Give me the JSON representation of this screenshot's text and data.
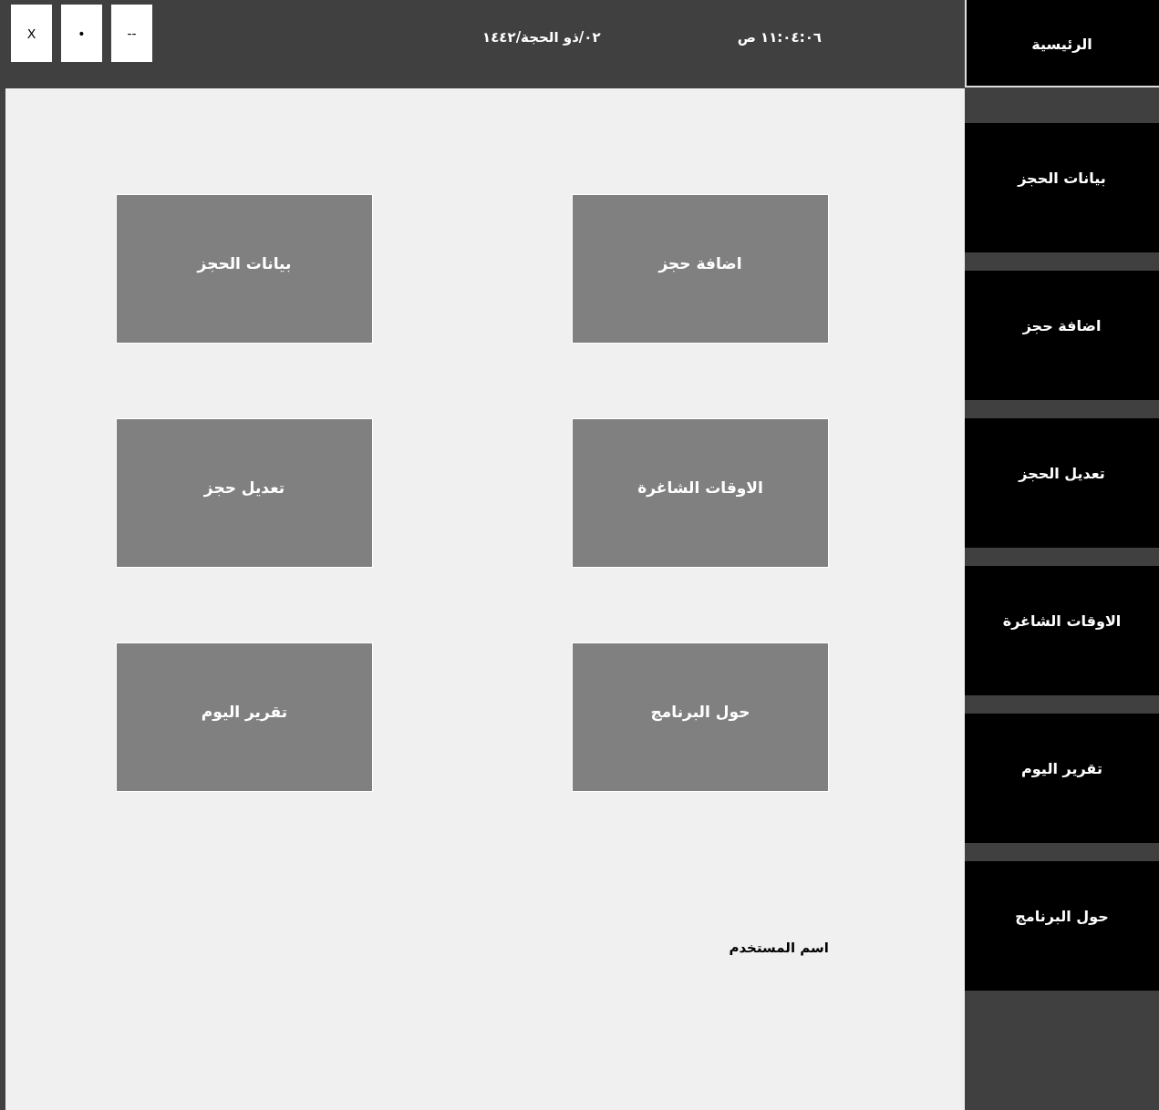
{
  "window_controls": [
    {
      "label": "--"
    },
    {
      "label": "•"
    },
    {
      "label": "X"
    }
  ],
  "header": {
    "date": "٠٢/ذو الحجة/١٤٤٢",
    "time": "١١:٠٤:٠٦ ص"
  },
  "sidebar": {
    "items": [
      {
        "label": "الرئيسية",
        "selected": true
      },
      {
        "label": "بيانات الحجز",
        "selected": false
      },
      {
        "label": "اضافة حجز",
        "selected": false
      },
      {
        "label": "تعديل الحجز",
        "selected": false
      },
      {
        "label": "الاوقات الشاغرة",
        "selected": false
      },
      {
        "label": "تقرير اليوم",
        "selected": false
      },
      {
        "label": "حول البرنامج",
        "selected": false
      }
    ]
  },
  "tiles": [
    {
      "label": "اضافة حجز"
    },
    {
      "label": "بيانات الحجز"
    },
    {
      "label": "الاوقات الشاغرة"
    },
    {
      "label": "تعديل حجز"
    },
    {
      "label": "حول البرنامج"
    },
    {
      "label": "تقرير اليوم"
    }
  ],
  "user_label": "اسم المستخدم"
}
